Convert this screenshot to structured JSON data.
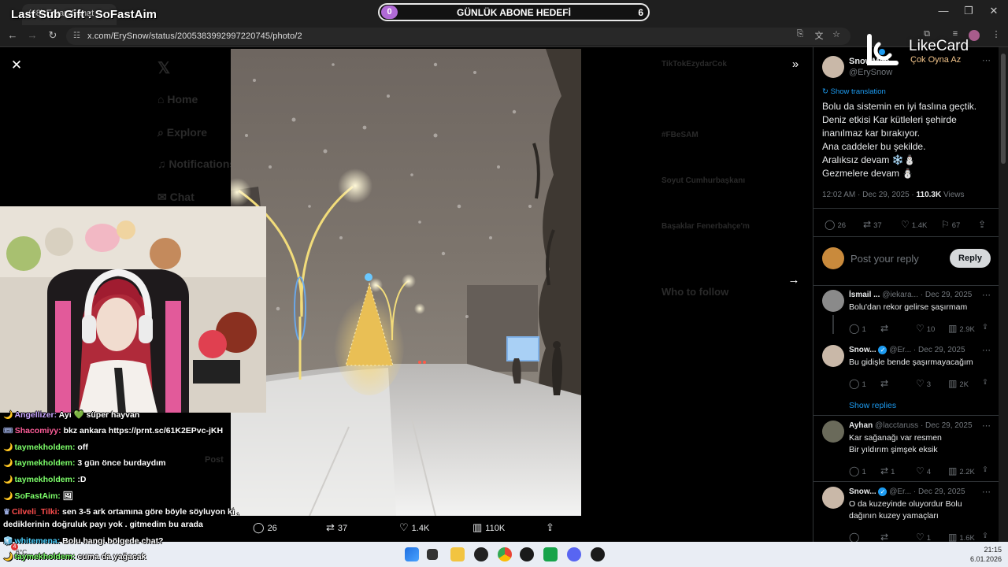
{
  "browser": {
    "tab_title": "(48) Erkan Sanat ...",
    "url": "x.com/ErySnow/status/2005383992997220745/photo/2",
    "window_controls": [
      "minimize-icon",
      "maximize-icon",
      "close-icon"
    ]
  },
  "overlay": {
    "sub_gift": "Last Sub Gift : SoFastAim",
    "goal": {
      "start": "0",
      "title": "GÜNLÜK ABONE HEDEFİ",
      "target": "6"
    },
    "brand": {
      "name": "LikeCard",
      "tagline": "Çok Oyna   Az"
    }
  },
  "viewer": {
    "close_icon": "close-icon",
    "expand_icon": "expand-icon",
    "next_icon": "arrow-right-icon",
    "actions": {
      "replies": "26",
      "reposts": "37",
      "likes": "1.4K",
      "views": "110K"
    }
  },
  "chat": [
    {
      "user": "Angellizer:",
      "msg": "Ayı 💚 süper hayvan",
      "color": "#c9a6ff"
    },
    {
      "user": "Shacomiyy:",
      "msg": "bkz ankara https://prnt.sc/61K2EPvc-jKH",
      "color": "#ff5e9a"
    },
    {
      "user": "taymekholdem:",
      "msg": "off",
      "color": "#7dff6a"
    },
    {
      "user": "taymekholdem:",
      "msg": "3 gün önce burdaydım",
      "color": "#7dff6a"
    },
    {
      "user": "taymekholdem:",
      "msg": ":D",
      "color": "#7dff6a"
    },
    {
      "user": "SoFastAim:",
      "msg": "🖼",
      "color": "#7dff6a"
    },
    {
      "user": "Cilveli_Tilki:",
      "msg": "sen 3-5 ark ortamına göre böyle söyluyon ki ,",
      "color": "#ff4d4d"
    },
    {
      "user": "",
      "msg": "dediklerinin doğruluk payı yok . gitmedim bu arada",
      "color": "#ffffff"
    },
    {
      "user": "whitemena:",
      "msg": "Bolu hangi bölgede chat?",
      "color": "#4dd2ff"
    },
    {
      "user": "taymekholdem:",
      "msg": "cuma da yağacak",
      "color": "#7dff6a"
    }
  ],
  "tweet": {
    "author_name": "SnowMan",
    "handle": "@ErySnow",
    "show_translation": "Show translation",
    "lines": [
      "Bolu da sistemin en iyi faslına geçtik.",
      "Deniz etkisi Kar kütleleri şehirde",
      "inanılmaz kar bırakıyor.",
      "Ana caddeler bu şekilde.",
      "Aralıksız devam ❄️⛄",
      "Gezmelere devam ⛄"
    ],
    "timestamp": "12:02 AM · Dec 29, 2025 · ",
    "views_count": "110.3K",
    "views_label": " Views",
    "actions": {
      "replies": "26",
      "reposts": "37",
      "likes": "1.4K",
      "bookmarks": "67"
    },
    "reply_placeholder": "Post your reply",
    "reply_button": "Reply"
  },
  "replies": [
    {
      "name": "İsmail ...",
      "handle": "@iekara...",
      "date": "· Dec 29, 2025",
      "lines": [
        "Bolu'dan rekor gelirse şaşırmam"
      ],
      "stats": [
        "1",
        "",
        "10",
        "2.9K"
      ],
      "verified": false
    },
    {
      "name": "Snow...",
      "handle": "@Er...",
      "date": "· Dec 29, 2025",
      "lines": [
        "Bu gidişle bende şaşırmayacağım"
      ],
      "stats": [
        "1",
        "",
        "3",
        "2K"
      ],
      "verified": true
    },
    {
      "name": "Ayhan",
      "handle": "@lacctaruss",
      "date": "· Dec 29, 2025",
      "lines": [
        "Kar sağanağı var resmen",
        "Bir yıldırım şimşek eksik"
      ],
      "stats": [
        "1",
        "1",
        "4",
        "2.2K"
      ],
      "verified": false
    },
    {
      "name": "Snow...",
      "handle": "@Er...",
      "date": "· Dec 29, 2025",
      "lines": [
        "O da kuzeyinde oluyordur Bolu",
        "dağının kuzey yamaçları"
      ],
      "stats": [
        "",
        "",
        "1",
        "1.6K"
      ],
      "verified": true
    }
  ],
  "show_replies": "Show replies",
  "taskbar": {
    "weather_temp": "6°C",
    "weather_badge": "4",
    "time": "21:15",
    "date": "6.01.2026"
  }
}
